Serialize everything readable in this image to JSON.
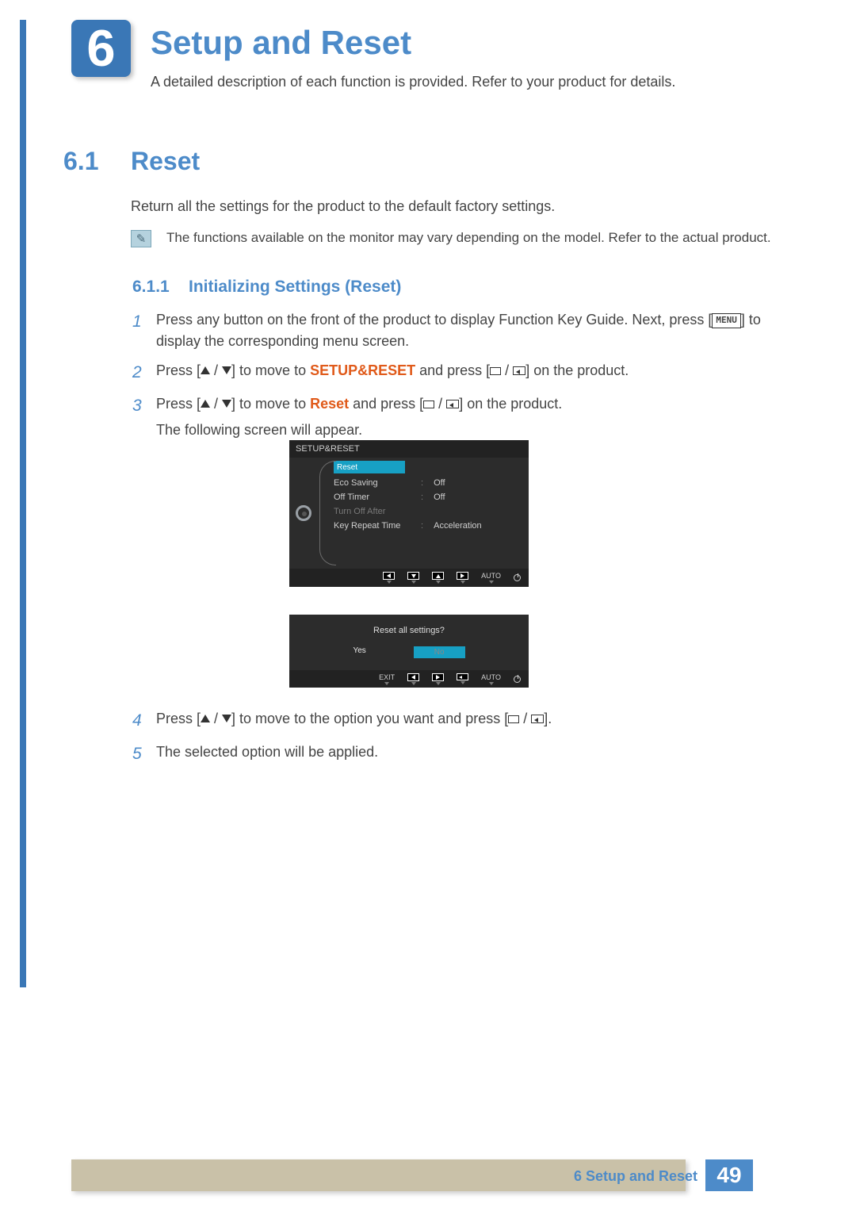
{
  "chapter_number": "6",
  "page_title": "Setup and Reset",
  "page_subtitle": "A detailed description of each function is provided. Refer to your product for details.",
  "section": {
    "num": "6.1",
    "title": "Reset",
    "desc": "Return all the settings for the product to the default factory settings."
  },
  "note_text": "The functions available on the monitor may vary depending on the model. Refer to the actual product.",
  "subsection": {
    "num": "6.1.1",
    "title": "Initializing Settings (Reset)"
  },
  "steps": {
    "s1_a": "Press any button on the front of the product to display Function Key Guide. Next, press [",
    "s1_menu": "MENU",
    "s1_b": "] to display the corresponding menu screen.",
    "s2_a": "Press [",
    "s2_b": "] to move to ",
    "s2_target": "SETUP&RESET",
    "s2_c": " and press [",
    "s2_d": "] on the product.",
    "s3_a": "Press [",
    "s3_b": "] to move to ",
    "s3_target": "Reset",
    "s3_c": " and press [",
    "s3_d": "] on the product.",
    "s3_e": "The following screen will appear.",
    "s4_a": "Press [",
    "s4_b": "] to move to the option you want and press [",
    "s4_c": "].",
    "s5": "The selected option will be applied."
  },
  "osd1": {
    "title": "SETUP&RESET",
    "items": [
      {
        "label": "Reset",
        "value": "",
        "selected": true
      },
      {
        "label": "Eco Saving",
        "value": "Off"
      },
      {
        "label": "Off Timer",
        "value": "Off"
      },
      {
        "label": "Turn Off After",
        "value": "",
        "dim": true
      },
      {
        "label": "Key Repeat Time",
        "value": "Acceleration"
      }
    ],
    "nav_auto": "AUTO"
  },
  "osd2": {
    "question": "Reset all settings?",
    "yes": "Yes",
    "no": "No",
    "exit": "EXIT",
    "auto": "AUTO"
  },
  "footer": {
    "text": "6 Setup and Reset",
    "page": "49"
  }
}
